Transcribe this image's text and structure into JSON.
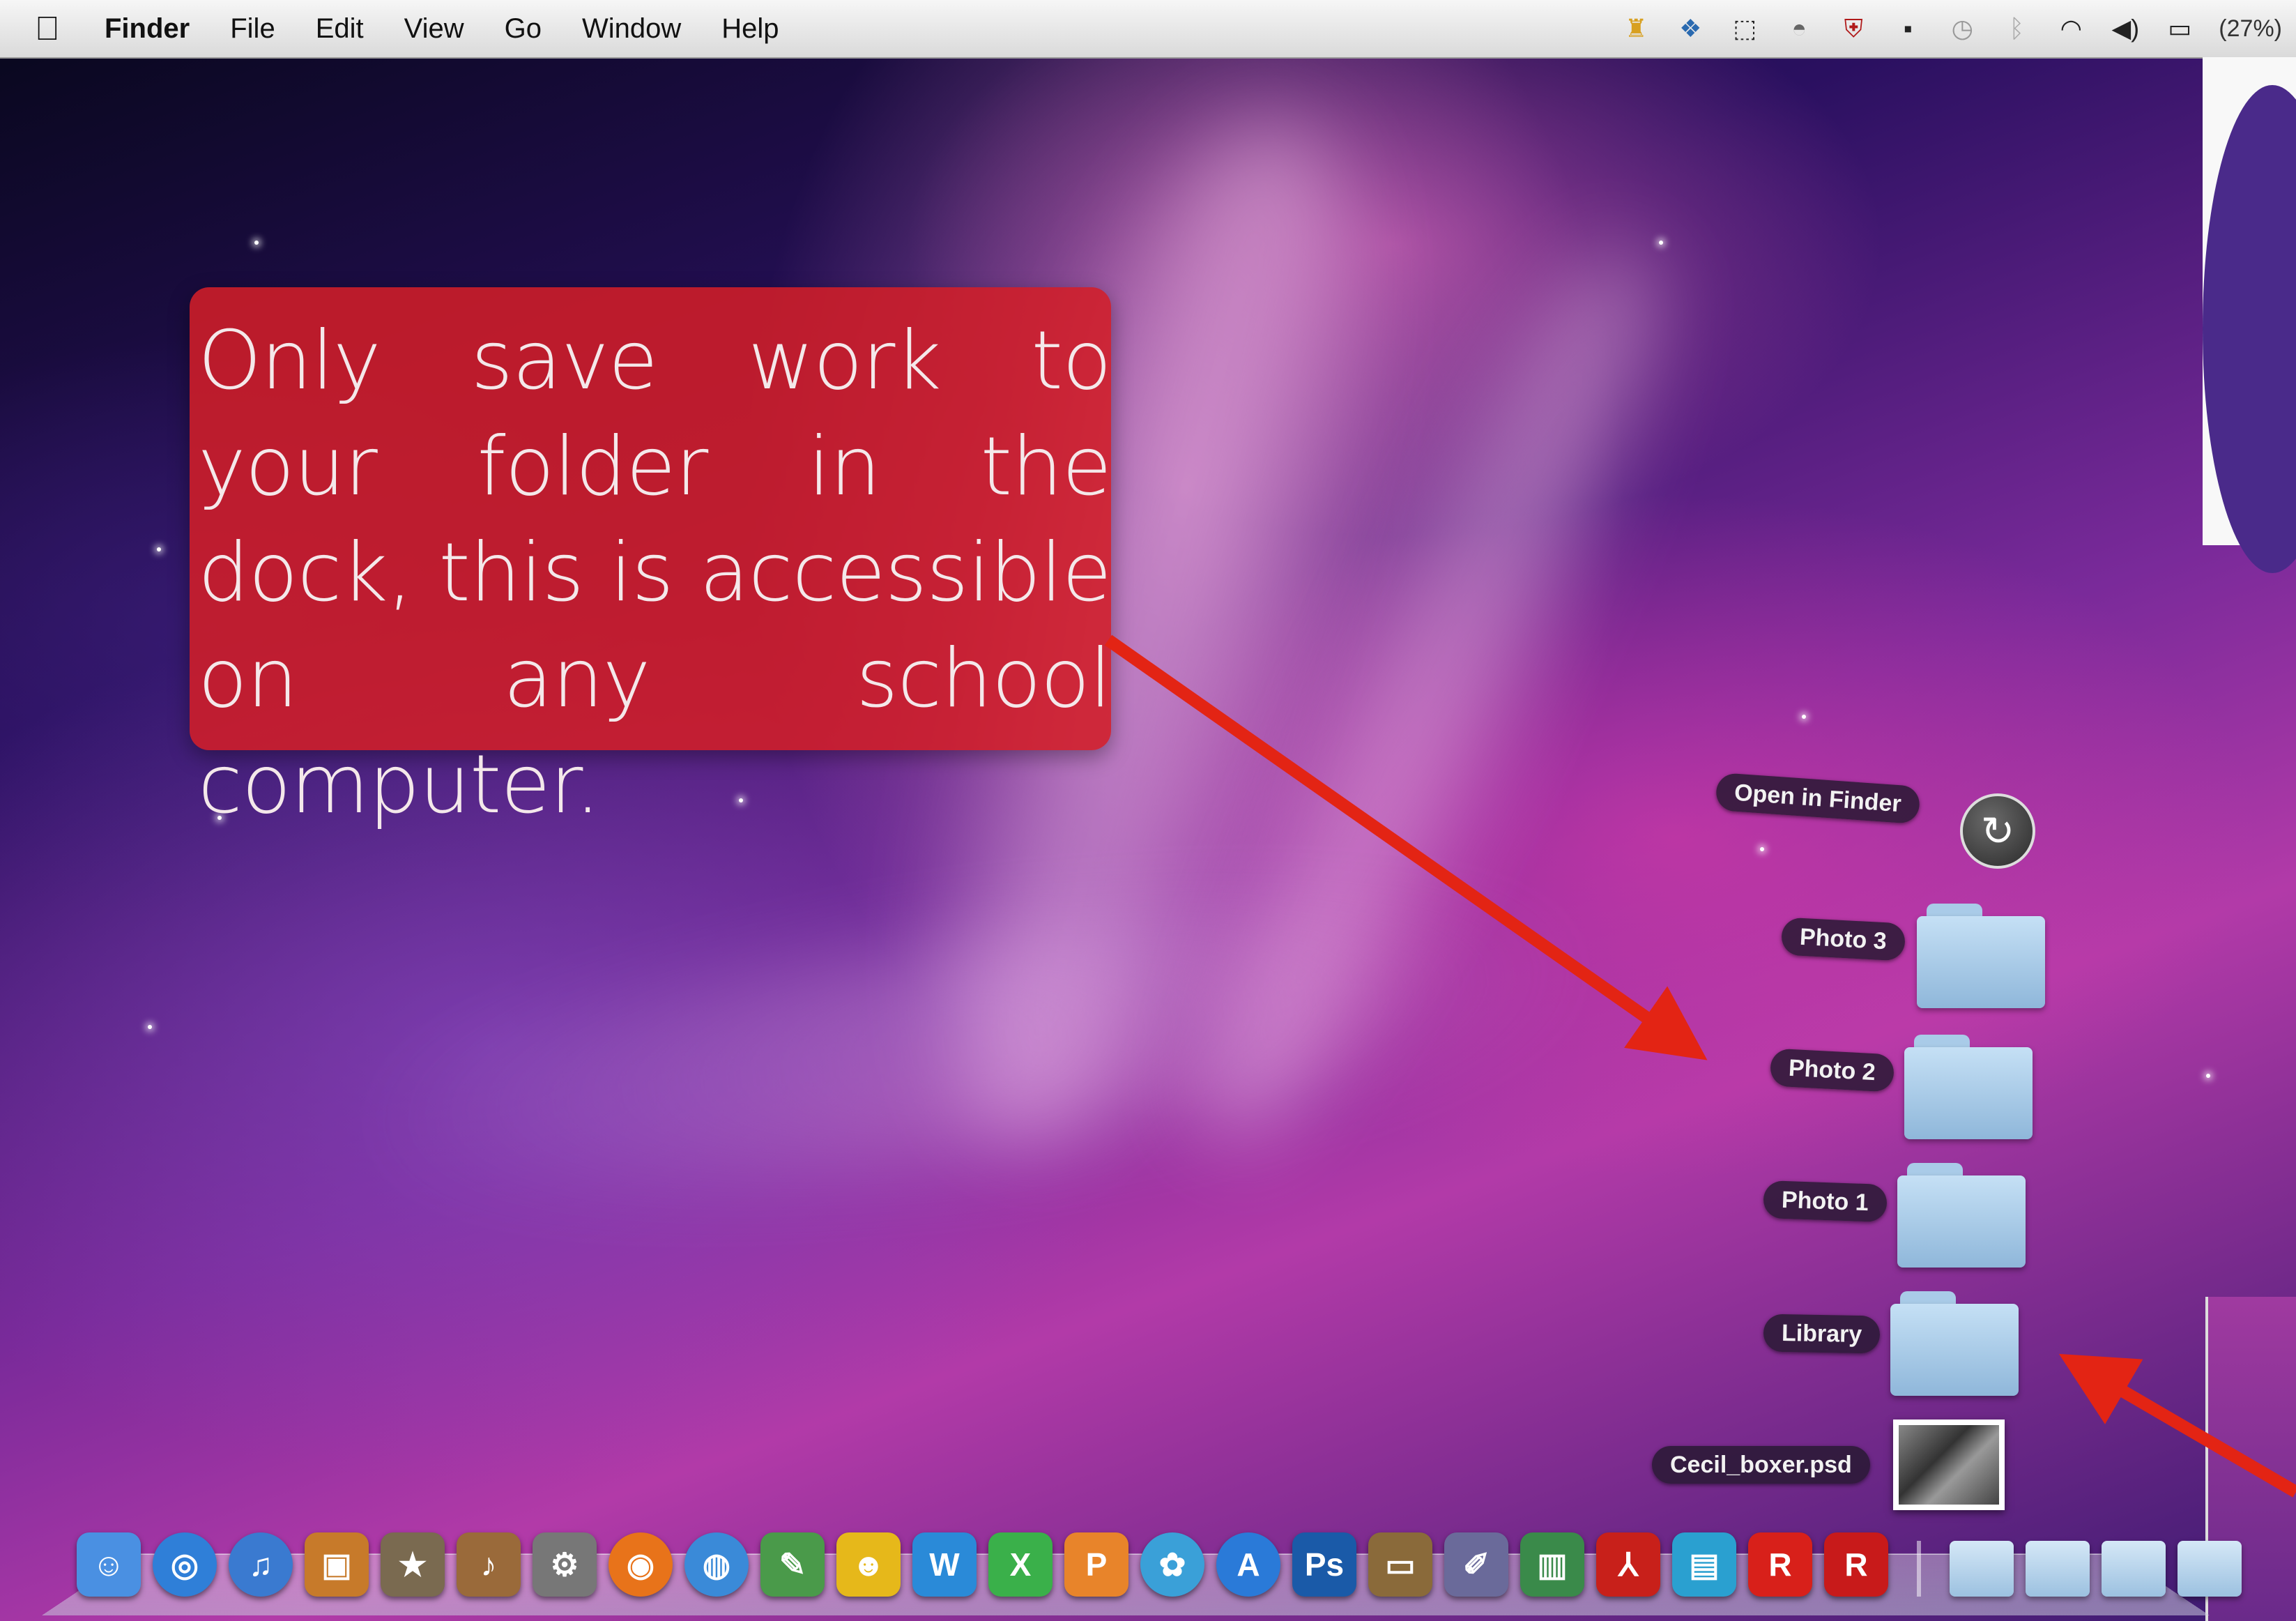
{
  "menubar": {
    "apple_icon": "apple-logo-icon",
    "app_name": "Finder",
    "menus": [
      "File",
      "Edit",
      "View",
      "Go",
      "Window",
      "Help"
    ],
    "status_icons": [
      "app-icon",
      "dropbox-icon",
      "screenshot-icon",
      "growl-icon",
      "mcafee-icon",
      "1password-icon",
      "time-machine-icon",
      "bluetooth-icon",
      "wifi-icon",
      "volume-icon",
      "battery-icon"
    ],
    "battery_percent": "(27%)"
  },
  "callout": {
    "text": "Only save work to your folder in the dock, this is accessible on any school computer."
  },
  "stack": {
    "open_in_finder_label": "Open in Finder",
    "items": [
      {
        "label": "Photo 3",
        "type": "folder"
      },
      {
        "label": "Photo 2",
        "type": "folder"
      },
      {
        "label": "Photo 1",
        "type": "folder"
      },
      {
        "label": "Library",
        "type": "folder"
      },
      {
        "label": "Cecil_boxer.psd",
        "type": "file"
      }
    ]
  },
  "dock": {
    "apps": [
      {
        "name": "finder-icon",
        "glyph": "☺",
        "color": "#4a90e2"
      },
      {
        "name": "safari-icon",
        "glyph": "◎",
        "color": "#2f7fd8"
      },
      {
        "name": "itunes-icon",
        "glyph": "♫",
        "color": "#3a7ad0"
      },
      {
        "name": "iphoto-icon",
        "glyph": "▣",
        "color": "#c77a2a"
      },
      {
        "name": "imovie-icon",
        "glyph": "★",
        "color": "#7a6a50"
      },
      {
        "name": "garageband-icon",
        "glyph": "♪",
        "color": "#9a6a3a"
      },
      {
        "name": "system-preferences-icon",
        "glyph": "⚙",
        "color": "#777"
      },
      {
        "name": "firefox-icon",
        "glyph": "◉",
        "color": "#e8731a"
      },
      {
        "name": "dvd-player-icon",
        "glyph": "◍",
        "color": "#3a8ad8"
      },
      {
        "name": "iweb-icon",
        "glyph": "✎",
        "color": "#4a9a4a"
      },
      {
        "name": "comic-life-icon",
        "glyph": "☻",
        "color": "#e6b81a"
      },
      {
        "name": "word-icon",
        "glyph": "W",
        "color": "#2a8ad8"
      },
      {
        "name": "excel-icon",
        "glyph": "X",
        "color": "#3ab04a"
      },
      {
        "name": "powerpoint-icon",
        "glyph": "P",
        "color": "#e8842a"
      },
      {
        "name": "messenger-icon",
        "glyph": "✿",
        "color": "#3aa0d8"
      },
      {
        "name": "app-store-icon",
        "glyph": "A",
        "color": "#2a7ad8"
      },
      {
        "name": "photoshop-icon",
        "glyph": "Ps",
        "color": "#1a5aa8"
      },
      {
        "name": "keynote-icon",
        "glyph": "▭",
        "color": "#8a6a3a"
      },
      {
        "name": "utility-icon",
        "glyph": "✐",
        "color": "#6a6a9a"
      },
      {
        "name": "numbers-icon",
        "glyph": "▥",
        "color": "#3a8a4a"
      },
      {
        "name": "acrobat-icon",
        "glyph": "⅄",
        "color": "#c8201a"
      },
      {
        "name": "preview-icon",
        "glyph": "▤",
        "color": "#2aa0d0"
      },
      {
        "name": "roblox-icon",
        "glyph": "R",
        "color": "#d8201a"
      },
      {
        "name": "roblox-studio-icon",
        "glyph": "R",
        "color": "#c81a1a"
      }
    ],
    "stacks": [
      "downloads-stack-icon",
      "documents-folder-icon",
      "user-folder-icon",
      "applications-folder-icon"
    ]
  },
  "colors": {
    "callout_bg": "#d21e28",
    "arrow": "#e32414"
  }
}
